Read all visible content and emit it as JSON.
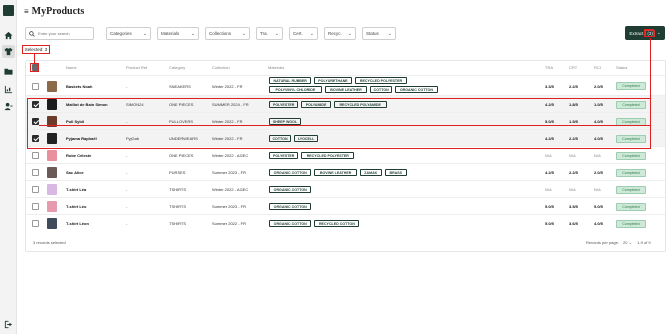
{
  "app": {
    "title": "MyProducts"
  },
  "sidebar": {
    "items": [
      "home",
      "tshirt",
      "folder",
      "analytics",
      "users",
      "logout"
    ]
  },
  "toolbar": {
    "search_placeholder": "Enter your search",
    "filters": [
      "Categories",
      "Materials",
      "Collections",
      "Tra.",
      "Cert.",
      "Recyc.",
      "Status"
    ],
    "export_label": "Extract",
    "export_count": "(3)"
  },
  "selected_label": "Selected: 3",
  "table": {
    "headers": [
      "Name",
      "Product Ref",
      "Category",
      "Collection",
      "Materials",
      "TRA",
      "CRT",
      "RCI",
      "Status"
    ],
    "rows": [
      {
        "name": "Baskets Noah",
        "ref": "-",
        "category": "SNEAKERS",
        "collection": "Winter 2022 - FR",
        "materials": [
          "NATURAL RUBBER",
          "POLYURETHANE",
          "RECYCLED POLYESTER",
          "POLYVINYL CHLORIDE",
          "BOVINE LEATHER",
          "COTTON",
          "ORGANIC COTTON"
        ],
        "tra": "3.3/5",
        "crt": "2.2/5",
        "rci": "2.0/5",
        "status": "Completed",
        "selected": false
      },
      {
        "name": "Maillot de Bain Simon",
        "ref": "SIMON24",
        "category": "ONE PIECES",
        "collection": "SUMMER 2024 - FR",
        "materials": [
          "POLYESTER",
          "POLYAMIDE",
          "RECYCLED POLYAMIDE"
        ],
        "tra": "4.2/5",
        "crt": "1.8/5",
        "rci": "1.0/5",
        "status": "Completed",
        "selected": true
      },
      {
        "name": "Pull Sybil",
        "ref": "-",
        "category": "PULLOVERS",
        "collection": "Winter 2022 - FR",
        "materials": [
          "SHEEP WOOL"
        ],
        "tra": "5.0/5",
        "crt": "1.5/5",
        "rci": "4.0/5",
        "status": "Completed",
        "selected": true
      },
      {
        "name": "Pyjama Raphaël",
        "ref": "PyjGab",
        "category": "UNDERWEARS",
        "collection": "Winter 2022 - FR",
        "materials": [
          "COTTON",
          "LYOCELL"
        ],
        "tra": "4.2/5",
        "crt": "2.2/5",
        "rci": "4.0/5",
        "status": "Completed",
        "selected": true
      },
      {
        "name": "Robe Céleste",
        "ref": "-",
        "category": "ONE PIECES",
        "collection": "Winter 2022 - AGEC",
        "materials": [
          "POLYESTER",
          "RECYCLED POLYESTER"
        ],
        "tra": "N/A",
        "crt": "N/A",
        "rci": "N/A",
        "status": "Completed",
        "selected": false
      },
      {
        "name": "Sac Alice",
        "ref": "-",
        "category": "PURSES",
        "collection": "Summer 2023 - FR",
        "materials": [
          "ORGANIC COTTON",
          "BOVINE LEATHER",
          "ZAMAK",
          "BRASS"
        ],
        "tra": "4.2/5",
        "crt": "2.2/5",
        "rci": "2.0/5",
        "status": "Completed",
        "selected": false
      },
      {
        "name": "T-shirt Léa",
        "ref": "-",
        "category": "TSHIRTS",
        "collection": "Winter 2022 - AGEC",
        "materials": [
          "ORGANIC COTTON"
        ],
        "tra": "N/A",
        "crt": "N/A",
        "rci": "N/A",
        "status": "Completed",
        "selected": false
      },
      {
        "name": "T-shirt Léo",
        "ref": "-",
        "category": "TSHIRTS",
        "collection": "Summer 2023 - FR",
        "materials": [
          "ORGANIC COTTON"
        ],
        "tra": "5.0/5",
        "crt": "3.5/5",
        "rci": "5.0/5",
        "status": "Completed",
        "selected": false
      },
      {
        "name": "T-shirt Léon",
        "ref": "-",
        "category": "TSHIRTS",
        "collection": "Summer 2022 - FR",
        "materials": [
          "ORGANIC COTTON",
          "RECYCLED COTTON"
        ],
        "tra": "5.0/5",
        "crt": "3.6/5",
        "rci": "4.0/5",
        "status": "Completed",
        "selected": false
      }
    ]
  },
  "footer": {
    "selected_rows": "3 records selected",
    "per_page_label": "Records per page:",
    "per_page_value": "20",
    "page_range": "1-9 of 9"
  },
  "colors": {
    "brand": "#1f3d33",
    "accent_red": "#e02020",
    "status_bg": "#cfe9d9"
  }
}
